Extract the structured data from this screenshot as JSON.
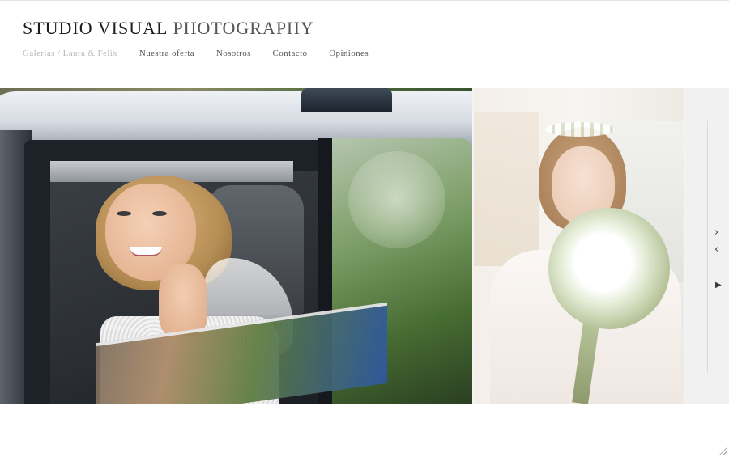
{
  "header": {
    "brand_primary": "STUDIO VISUAL",
    "brand_secondary": "PHOTOGRAPHY"
  },
  "nav": {
    "breadcrumb": "Galerias / Laura & Felix",
    "items": [
      {
        "label": "Nuestra oferta"
      },
      {
        "label": "Nosotros"
      },
      {
        "label": "Contacto"
      },
      {
        "label": "Opiniones"
      }
    ]
  },
  "gallery": {
    "controls": {
      "next_icon": "›",
      "prev_icon": "‹",
      "play_icon": "▶"
    }
  },
  "colors": {
    "brand_text": "#1d1d1d",
    "brand_secondary": "#555555",
    "breadcrumb": "#b9b9b9",
    "nav_text": "#555555"
  }
}
